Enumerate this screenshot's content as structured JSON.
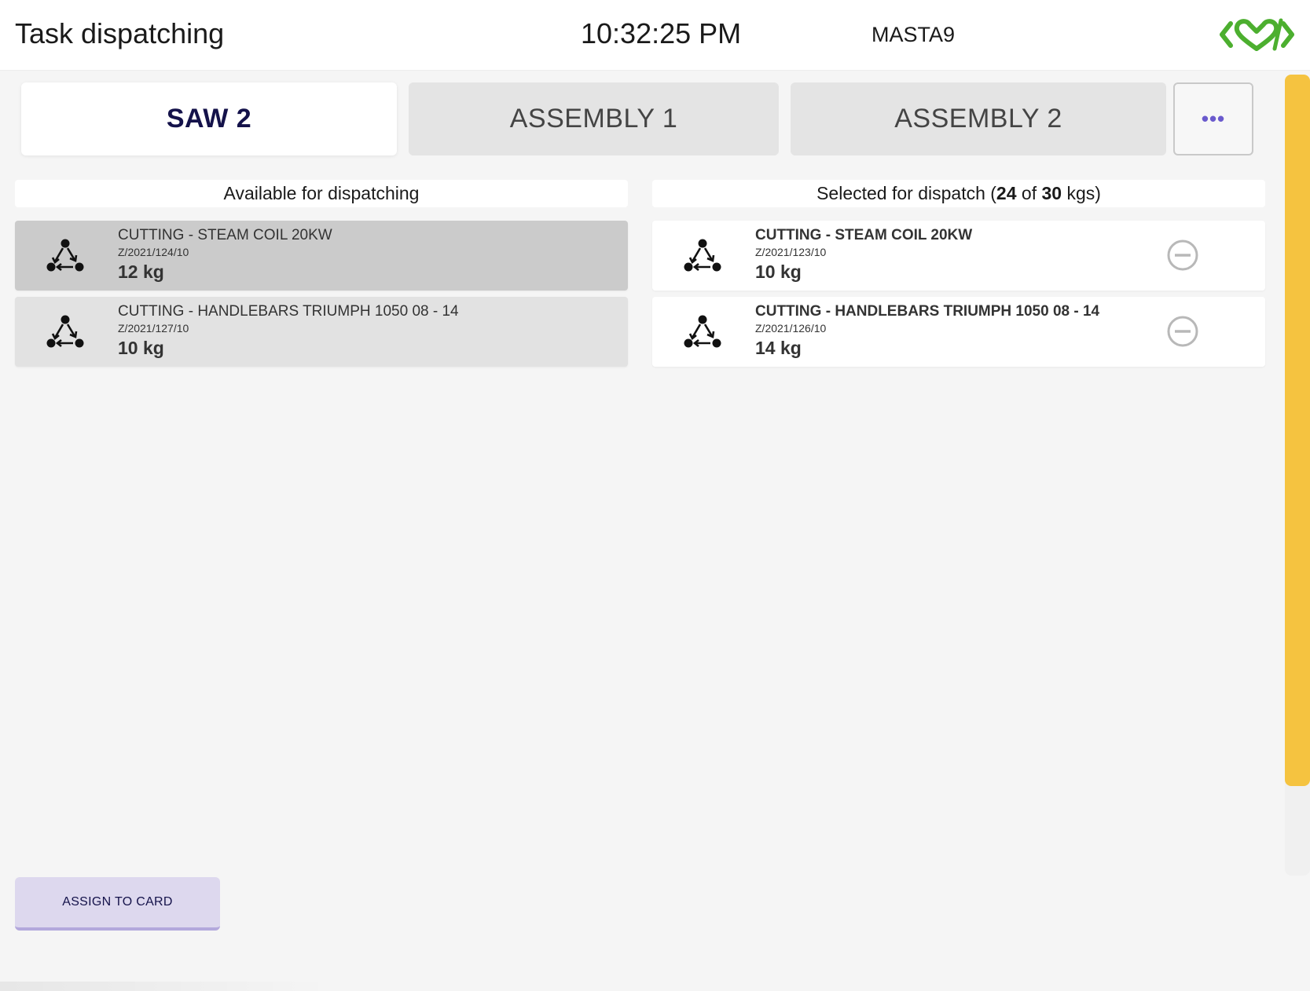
{
  "header": {
    "title": "Task dispatching",
    "clock": "10:32:25 PM",
    "user": "MASTA9",
    "logo_icon": "heart-code-logo-icon",
    "logo_color": "#4caf2f"
  },
  "tabs": [
    {
      "label": "SAW 2",
      "active": true
    },
    {
      "label": "ASSEMBLY 1",
      "active": false
    },
    {
      "label": "ASSEMBLY 2",
      "active": false
    }
  ],
  "more_tab": {
    "label": "•••",
    "icon": "ellipsis-icon"
  },
  "available": {
    "header": "Available for dispatching",
    "items": [
      {
        "name": "CUTTING - STEAM COIL 20KW",
        "code": "Z/2021/124/10",
        "weight": "12 kg",
        "icon": "workflow-triangle-icon",
        "highlighted": true
      },
      {
        "name": "CUTTING - HANDLEBARS TRIUMPH 1050 08 - 14",
        "code": "Z/2021/127/10",
        "weight": "10 kg",
        "icon": "workflow-triangle-icon",
        "highlighted": false
      }
    ]
  },
  "selected": {
    "header_prefix": "Selected for dispatch (",
    "current": "24",
    "of_word": " of ",
    "capacity": "30",
    "header_suffix": " kgs)",
    "items": [
      {
        "name": "CUTTING - STEAM COIL 20KW",
        "code": "Z/2021/123/10",
        "weight": "10 kg",
        "icon": "workflow-triangle-icon",
        "action_icon": "remove-circle-icon"
      },
      {
        "name": "CUTTING - HANDLEBARS TRIUMPH 1050 08 - 14",
        "code": "Z/2021/126/10",
        "weight": "14 kg",
        "icon": "workflow-triangle-icon",
        "action_icon": "remove-circle-icon"
      }
    ]
  },
  "actions": {
    "assign_label": "ASSIGN TO CARD"
  },
  "colors": {
    "accent": "#6a5acd",
    "scrollbar": "#f5c340",
    "active_tab_text": "#14124a"
  }
}
